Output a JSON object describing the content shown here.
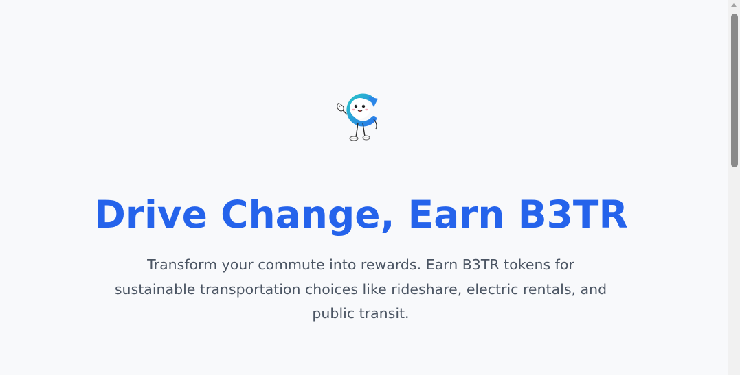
{
  "hero": {
    "mascot_icon": "recycle-mascot-icon",
    "title": "Drive Change, Earn B3TR",
    "subtitle": "Transform your commute into rewards. Earn B3TR tokens for sustainable transportation choices like rideshare, electric rentals, and public transit."
  },
  "colors": {
    "page_background": "#f8f9fb",
    "title": "#2563eb",
    "subtitle": "#4b5563",
    "mascot_gradient_start": "#28b8c8",
    "mascot_gradient_end": "#2b86e8",
    "scroll_thumb": "#8b8b8b"
  }
}
